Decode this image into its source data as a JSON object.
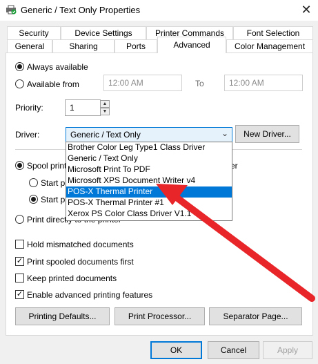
{
  "window": {
    "title": "Generic / Text Only Properties",
    "close_glyph": "✕",
    "icon": "printer-icon"
  },
  "tabs_row1": [
    {
      "label": "Security"
    },
    {
      "label": "Device Settings"
    },
    {
      "label": "Printer Commands"
    },
    {
      "label": "Font Selection"
    }
  ],
  "tabs_row2": [
    {
      "label": "General"
    },
    {
      "label": "Sharing"
    },
    {
      "label": "Ports"
    },
    {
      "label": "Advanced",
      "active": true
    },
    {
      "label": "Color Management"
    }
  ],
  "availability": {
    "always_label": "Always available",
    "always_selected": true,
    "from_label": "Available from",
    "from_time": "12:00 AM",
    "to_label": "To",
    "to_time": "12:00 AM"
  },
  "priority": {
    "label": "Priority:",
    "value": "1"
  },
  "driver": {
    "label": "Driver:",
    "selected": "Generic / Text Only",
    "new_button": "New Driver...",
    "options": [
      "Brother Color Leg Type1 Class Driver",
      "Generic / Text Only",
      "Microsoft Print To PDF",
      "Microsoft XPS Document Writer v4",
      "POS-X Thermal Printer",
      "POS-X Thermal Printer #1",
      "Xerox PS Color Class Driver V1.1"
    ],
    "highlighted_index": 4
  },
  "spool": {
    "spool_label": "Spool print",
    "spool_suffix": "er",
    "start_after_label": "Start p",
    "start_immediately_label": "Start p",
    "direct_label": "Print directly to the printer"
  },
  "options": {
    "hold_mismatched": {
      "label": "Hold mismatched documents",
      "checked": false
    },
    "spooled_first": {
      "label": "Print spooled documents first",
      "checked": true
    },
    "keep_printed": {
      "label": "Keep printed documents",
      "checked": false
    },
    "advanced_features": {
      "label": "Enable advanced printing features",
      "checked": true
    }
  },
  "bottom_buttons": {
    "defaults": "Printing Defaults...",
    "processor": "Print Processor...",
    "separator": "Separator Page..."
  },
  "dialog_buttons": {
    "ok": "OK",
    "cancel": "Cancel",
    "apply": "Apply"
  },
  "colors": {
    "accent": "#0078d7",
    "annotation_arrow": "#e8262a"
  },
  "glyphs": {
    "check": "✓",
    "spin_up": "▲",
    "spin_down": "▼",
    "chevron": "⌄"
  }
}
